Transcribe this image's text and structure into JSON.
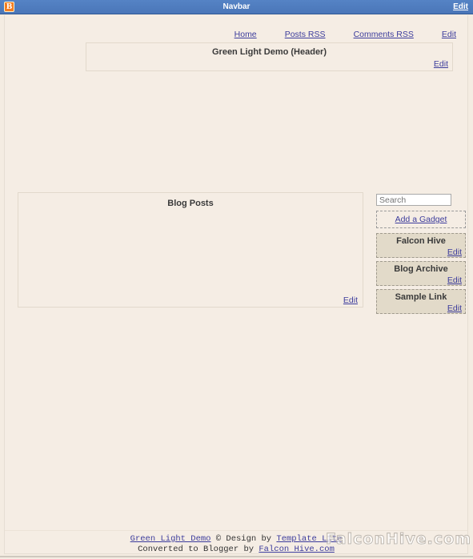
{
  "navbar": {
    "logo_icon": "blogger-b-icon",
    "logo_letter": "B",
    "title": "Navbar",
    "edit_label": "Edit",
    "background_color": "#4d7cbe"
  },
  "toplinks": [
    {
      "label": "Home",
      "name": "home"
    },
    {
      "label": "Posts RSS",
      "name": "posts-rss"
    },
    {
      "label": "Comments RSS",
      "name": "comments-rss"
    },
    {
      "label": "Edit",
      "name": "edit"
    }
  ],
  "header": {
    "title": "Green Light Demo (Header)",
    "edit_label": "Edit"
  },
  "main": {
    "title": "Blog Posts",
    "edit_label": "Edit"
  },
  "sidebar": {
    "search": {
      "value": "",
      "placeholder": "Search"
    },
    "add_gadget_label": "Add a Gadget",
    "gadgets": [
      {
        "title": "Falcon Hive",
        "edit_label": "Edit"
      },
      {
        "title": "Blog Archive",
        "edit_label": "Edit"
      },
      {
        "title": "Sample Link",
        "edit_label": "Edit"
      }
    ]
  },
  "footer": {
    "line1_link1": "Green Light Demo",
    "line1_mid": " © Design by ",
    "line1_link2": "Template Lite",
    "line2_text": "Converted to Blogger by ",
    "line2_link": "Falcon Hive.com"
  },
  "watermark": {
    "text": "FalconHive.com"
  },
  "colors": {
    "page_background": "#f5ede4",
    "navbar_blue": "#4d7cbe",
    "link_blue": "#3c3c9c",
    "gadget_fill": "#e2dac9"
  }
}
